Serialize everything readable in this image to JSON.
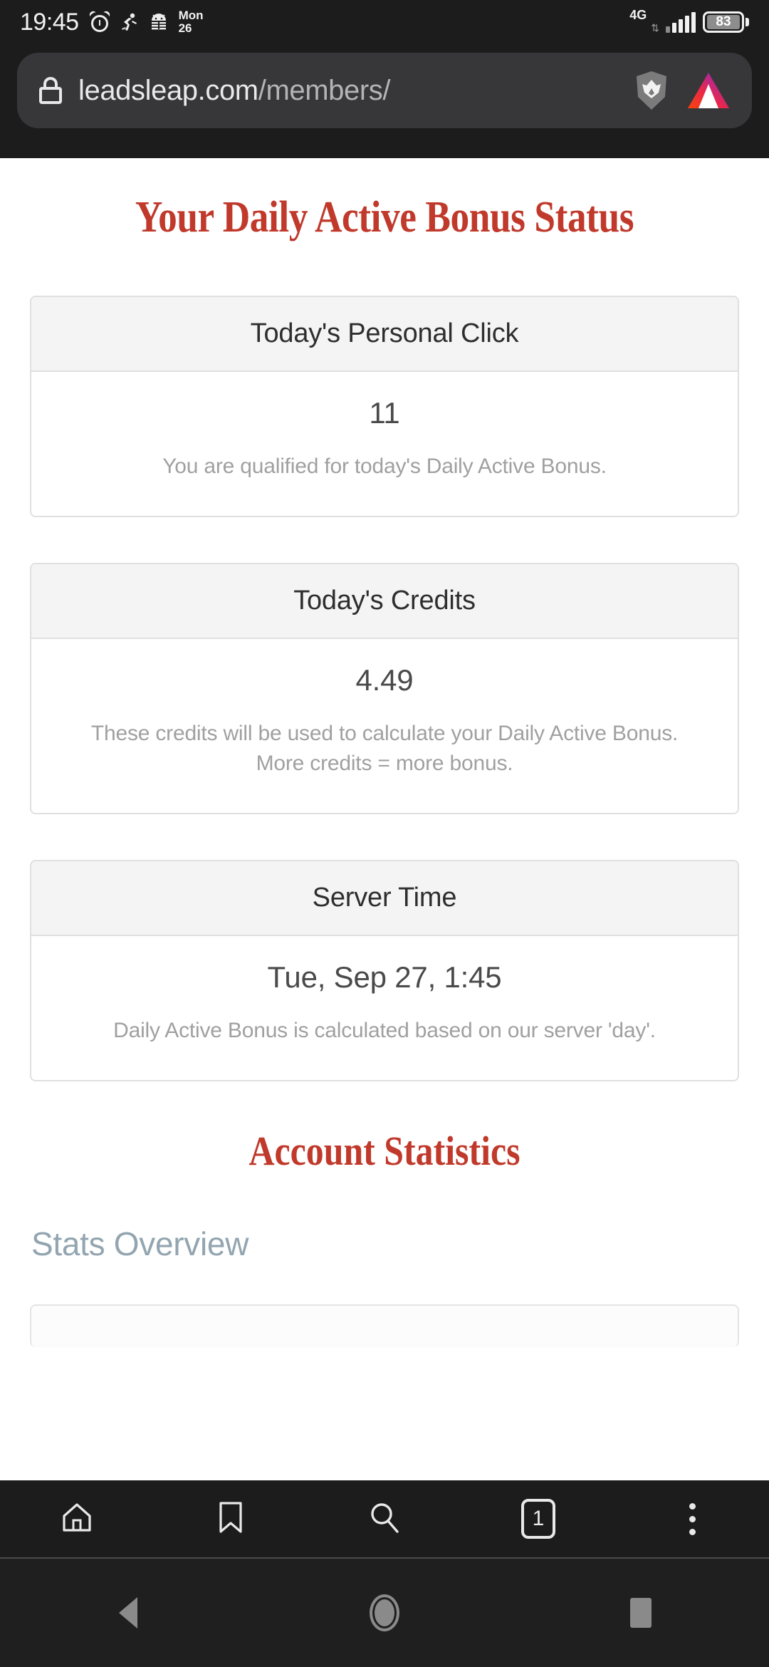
{
  "status_bar": {
    "time": "19:45",
    "date_day": "Mon",
    "date_num": "26",
    "network": "4G",
    "battery_percent": "83",
    "icons": [
      "alarm-icon",
      "running-activity-icon",
      "android-robot-icon",
      "signal-bars-icon",
      "battery-icon"
    ]
  },
  "browser": {
    "url_domain": "leadsleap.com",
    "url_path": "/members/",
    "lock_icon": "lock-icon",
    "shield_icon": "brave-shield-icon",
    "leo_icon": "brave-leo-icon",
    "toolbar": {
      "home_label": "home-icon",
      "bookmarks_label": "bookmark-icon",
      "search_label": "search-icon",
      "tab_count": "1",
      "menu_label": "kebab-menu-icon"
    }
  },
  "page": {
    "title": "Your Daily Active Bonus Status",
    "cards": [
      {
        "header": "Today's Personal Click",
        "value": "11",
        "note": "You are qualified for today's Daily Active Bonus."
      },
      {
        "header": "Today's Credits",
        "value": "4.49",
        "note_line1": "These credits will be used to calculate your Daily Active Bonus.",
        "note_line2": "More credits = more bonus."
      },
      {
        "header": "Server Time",
        "value": "Tue, Sep 27, 1:45",
        "note": "Daily Active Bonus is calculated based on our server 'day'."
      }
    ],
    "section_title": "Account Statistics",
    "stats_overview_label": "Stats Overview"
  },
  "android_nav": {
    "back": "back-triangle-icon",
    "home": "home-circle-icon",
    "recents": "recents-square-icon"
  },
  "colors": {
    "brand_red": "#c0392b",
    "chrome_dark": "#1c1c1c",
    "urlbar_bg": "#37373a",
    "card_head_bg": "#f4f4f4",
    "muted_text": "#a0a0a0",
    "stats_blue_gray": "#92a5b0"
  }
}
